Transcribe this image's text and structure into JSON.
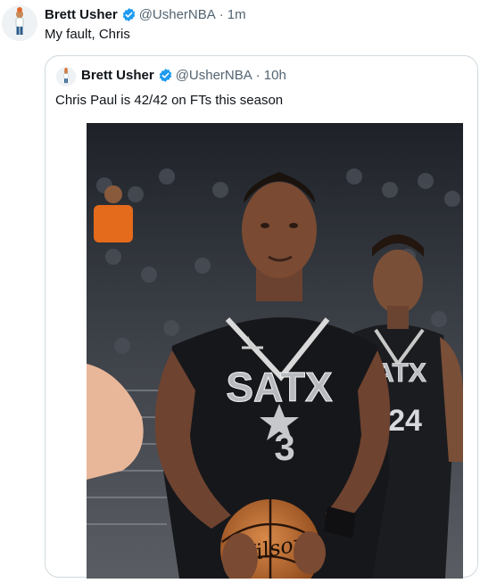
{
  "tweet": {
    "author_name": "Brett Usher",
    "handle": "@UsherNBA",
    "time": "1m",
    "separator": "·",
    "text": "My fault, Chris"
  },
  "quoted_tweet": {
    "author_name": "Brett Usher",
    "handle": "@UsherNBA",
    "time": "10h",
    "separator": "·",
    "text": "Chris Paul is 42/42 on FTs this season"
  },
  "media": {
    "jersey_left": {
      "wordmark": "SATX",
      "number": "3"
    },
    "jersey_right": {
      "wordmark": "SATX",
      "number": "24"
    },
    "ball_brand": "Wilson"
  },
  "colors": {
    "verified": "#1d9bf0",
    "secondary_text": "#536471",
    "border": "#cfd9de"
  },
  "icons": {
    "verified": "verified-badge-icon"
  }
}
